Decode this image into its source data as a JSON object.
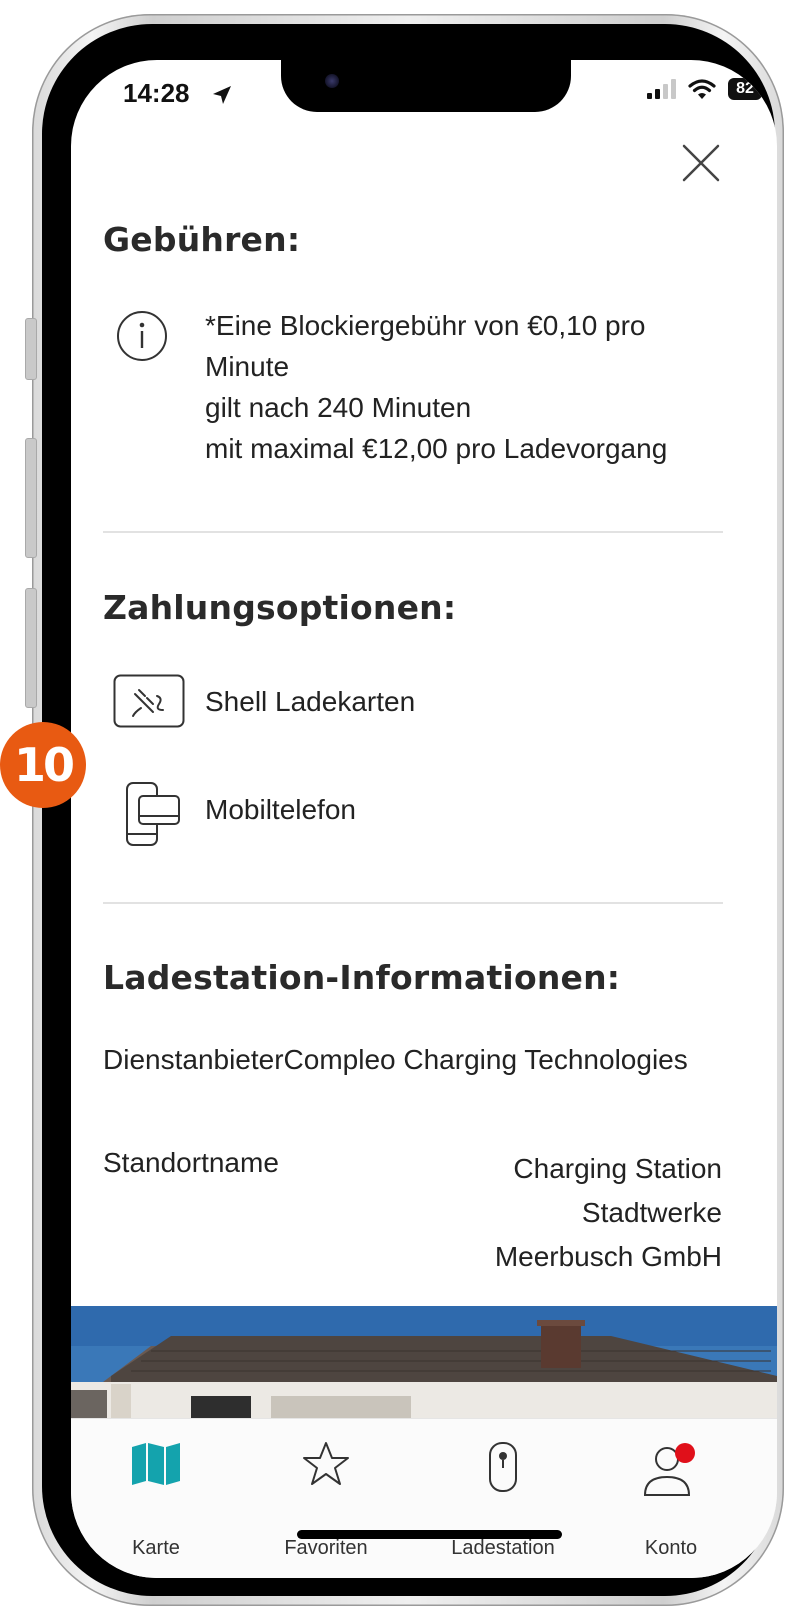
{
  "status_bar": {
    "time": "14:28",
    "battery": "82"
  },
  "fees": {
    "heading": "Gebühren:",
    "lines": [
      "*Eine Blockiergebühr von €0,10 pro",
      "Minute",
      "gilt nach 240 Minuten",
      "mit maximal €12,00 pro Ladevorgang"
    ]
  },
  "payment": {
    "heading": "Zahlungsoptionen:",
    "options": [
      {
        "label": "Shell Ladekarten",
        "icon": "charging-card-icon"
      },
      {
        "label": "Mobiltelefon",
        "icon": "mobile-phone-icon"
      }
    ]
  },
  "station_info": {
    "heading": "Ladestation-Informationen:",
    "provider_row": "DienstanbieterCompleo Charging Technologies",
    "location_label": "Standortname",
    "location_value": [
      "Charging Station",
      "Stadtwerke",
      "Meerbusch GmbH"
    ]
  },
  "tabbar": {
    "tabs": [
      {
        "label": "Karte",
        "icon": "map-icon"
      },
      {
        "label": "Favoriten",
        "icon": "star-icon"
      },
      {
        "label": "Ladestation",
        "icon": "charging-station-icon"
      },
      {
        "label": "Konto",
        "icon": "account-icon"
      }
    ]
  },
  "step_badge": "10",
  "colors": {
    "accent_teal": "#14a3ad",
    "badge_orange": "#e85a12",
    "notification_red": "#e0101a"
  }
}
